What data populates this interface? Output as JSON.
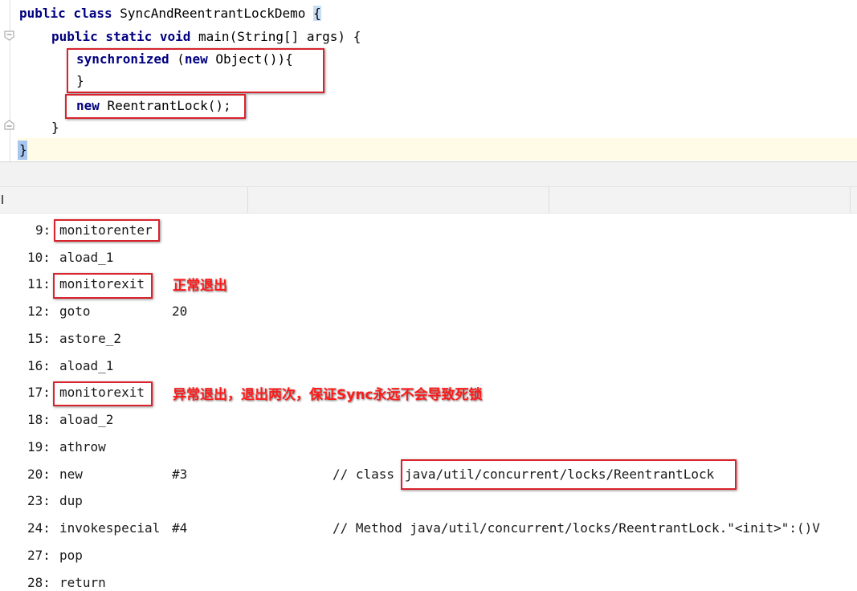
{
  "editor": {
    "line1": {
      "kw": "public class",
      "name": "SyncAndReentrantLockDemo",
      "brace": "{"
    },
    "line2": {
      "kw": "public static void",
      "rest": "main(String[] args) {"
    },
    "line3": {
      "kw1": "synchronized",
      "mid": "(",
      "kw2": "new",
      "rest": "Object()){"
    },
    "line4": "}",
    "line5": {
      "kw": "new",
      "rest": "ReentrantLock();"
    },
    "line6": "}",
    "line7": "}"
  },
  "bytecode": [
    {
      "offset": "9:",
      "op": "monitorenter",
      "arg": "",
      "comment": ""
    },
    {
      "offset": "10:",
      "op": "aload_1",
      "arg": "",
      "comment": ""
    },
    {
      "offset": "11:",
      "op": "monitorexit",
      "arg": "",
      "comment": ""
    },
    {
      "offset": "12:",
      "op": "goto",
      "arg": "20",
      "comment": ""
    },
    {
      "offset": "15:",
      "op": "astore_2",
      "arg": "",
      "comment": ""
    },
    {
      "offset": "16:",
      "op": "aload_1",
      "arg": "",
      "comment": ""
    },
    {
      "offset": "17:",
      "op": "monitorexit",
      "arg": "",
      "comment": ""
    },
    {
      "offset": "18:",
      "op": "aload_2",
      "arg": "",
      "comment": ""
    },
    {
      "offset": "19:",
      "op": "athrow",
      "arg": "",
      "comment": ""
    },
    {
      "offset": "20:",
      "op": "new",
      "arg": "#3",
      "comment": "// class",
      "comment2": "java/util/concurrent/locks/ReentrantLock"
    },
    {
      "offset": "23:",
      "op": "dup",
      "arg": "",
      "comment": ""
    },
    {
      "offset": "24:",
      "op": "invokespecial",
      "arg": "#4",
      "comment": "// Method java/util/concurrent/locks/ReentrantLock.\"<init>\":()V"
    },
    {
      "offset": "27:",
      "op": "pop",
      "arg": "",
      "comment": ""
    },
    {
      "offset": "28:",
      "op": "return",
      "arg": "",
      "comment": ""
    }
  ],
  "annotations": {
    "normal_exit": "正常退出",
    "abnormal_exit": "异常退出，退出两次，保证Sync永远不会导致死锁"
  },
  "colors": {
    "highlight_box": "#d9232d",
    "annotation_text": "#ff1a1a",
    "keyword": "#000080"
  }
}
